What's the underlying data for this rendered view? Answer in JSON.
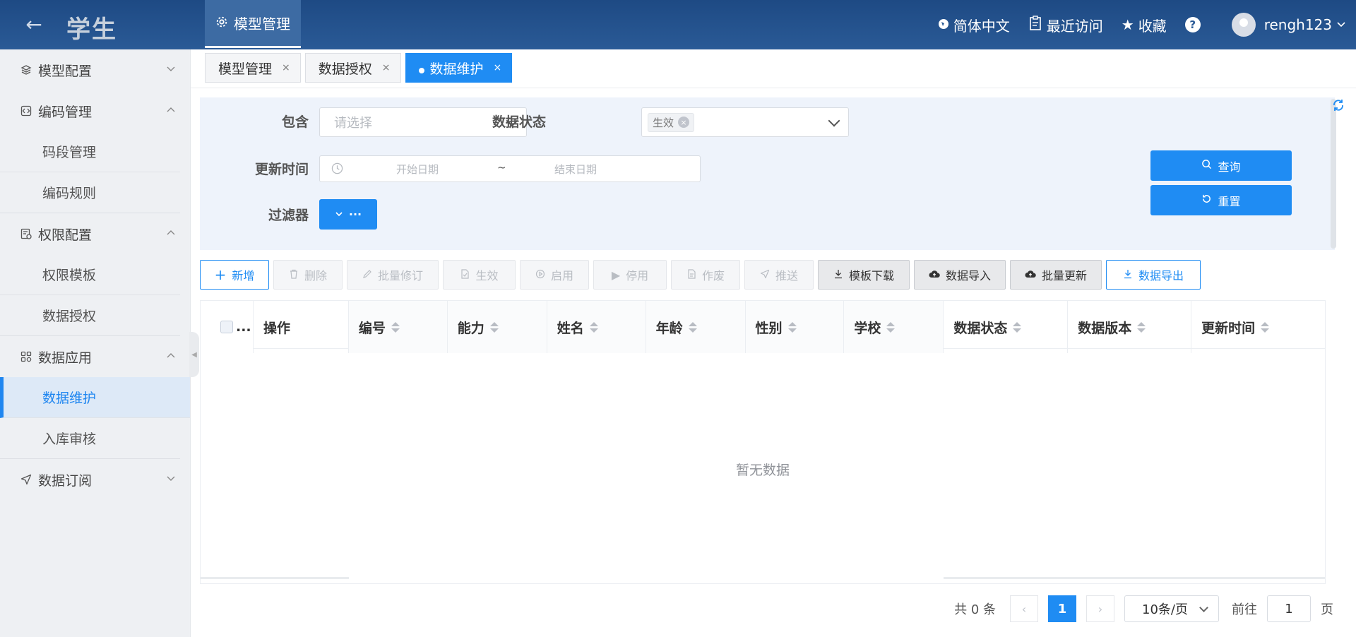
{
  "app": {
    "title": "学生"
  },
  "top_tab": {
    "label": "模型管理"
  },
  "top_right": {
    "language": "简体中文",
    "recent": "最近访问",
    "favorites": "收藏",
    "help": "?",
    "username": "rengh123"
  },
  "sidebar": {
    "groups": [
      {
        "label": "模型配置"
      },
      {
        "label": "编码管理",
        "items": [
          "码段管理",
          "编码规则"
        ]
      },
      {
        "label": "权限配置",
        "items": [
          "权限模板",
          "数据授权"
        ]
      },
      {
        "label": "数据应用",
        "items": [
          "数据维护",
          "入库审核"
        ]
      },
      {
        "label": "数据订阅"
      }
    ]
  },
  "page_tabs": [
    {
      "label": "模型管理",
      "close": "×"
    },
    {
      "label": "数据授权",
      "close": "×"
    },
    {
      "label": "数据维护",
      "close": "×"
    }
  ],
  "filter": {
    "contains_label": "包含",
    "contains_placeholder": "请选择",
    "status_label": "数据状态",
    "status_tag": "生效",
    "update_time_label": "更新时间",
    "start_date": "开始日期",
    "date_sep": "~",
    "end_date": "结束日期",
    "filter_label": "过滤器",
    "filter_btn": "···",
    "query_btn": "查询",
    "reset_btn": "重置"
  },
  "toolbar": {
    "add": "新增",
    "delete": "删除",
    "batch_revise": "批量修订",
    "effective": "生效",
    "enable": "启用",
    "disable": "停用",
    "void": "作废",
    "push": "推送",
    "template_download": "模板下载",
    "data_import": "数据导入",
    "batch_update": "批量更新",
    "data_export": "数据导出"
  },
  "table": {
    "select_all": "...",
    "columns": [
      "操作",
      "编号",
      "能力",
      "姓名",
      "年龄",
      "性别",
      "学校",
      "数据状态",
      "数据版本",
      "更新时间"
    ],
    "empty": "暂无数据"
  },
  "pagination": {
    "total": "共 0 条",
    "current_page": "1",
    "page_size": "10条/页",
    "goto_prefix": "前往",
    "goto_value": "1",
    "goto_suffix": "页"
  }
}
